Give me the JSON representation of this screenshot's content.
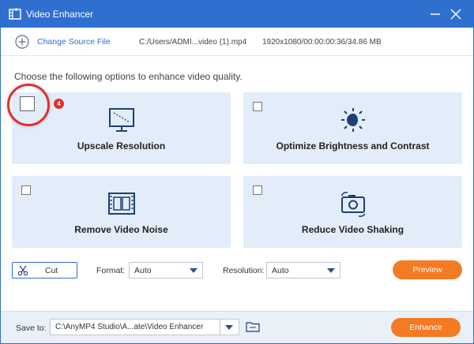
{
  "window": {
    "title": "Video Enhancer",
    "accent_color": "#2f6fd0",
    "icons": {
      "app": "film-grid-icon",
      "minimize": "minimize-icon",
      "close": "close-icon"
    }
  },
  "source": {
    "change_label": "Change Source File",
    "file_path": "C:/Users/ADMI...video (1).mp4",
    "file_info": "1920x1080/00:00:00:36/34.86 MB"
  },
  "prompt": "Choose the following options to enhance video quality.",
  "options": [
    {
      "label": "Upscale Resolution",
      "icon": "monitor-icon",
      "checked": false
    },
    {
      "label": "Optimize Brightness and Contrast",
      "icon": "brightness-icon",
      "checked": false
    },
    {
      "label": "Remove Video Noise",
      "icon": "film-strip-icon",
      "checked": false
    },
    {
      "label": "Reduce Video Shaking",
      "icon": "stabilize-camera-icon",
      "checked": false
    }
  ],
  "annotation": {
    "step_number": "4",
    "color": "#e02f2f"
  },
  "controls": {
    "cut_label": "Cut",
    "format_label": "Format:",
    "format_value": "Auto",
    "resolution_label": "Resolution:",
    "resolution_value": "Auto",
    "preview_label": "Preview",
    "button_color": "#f47a24"
  },
  "footer": {
    "save_label": "Save to:",
    "save_path": "C:\\AnyMP4 Studio\\A...ate\\Video Enhancer",
    "enhance_label": "Enhance"
  }
}
